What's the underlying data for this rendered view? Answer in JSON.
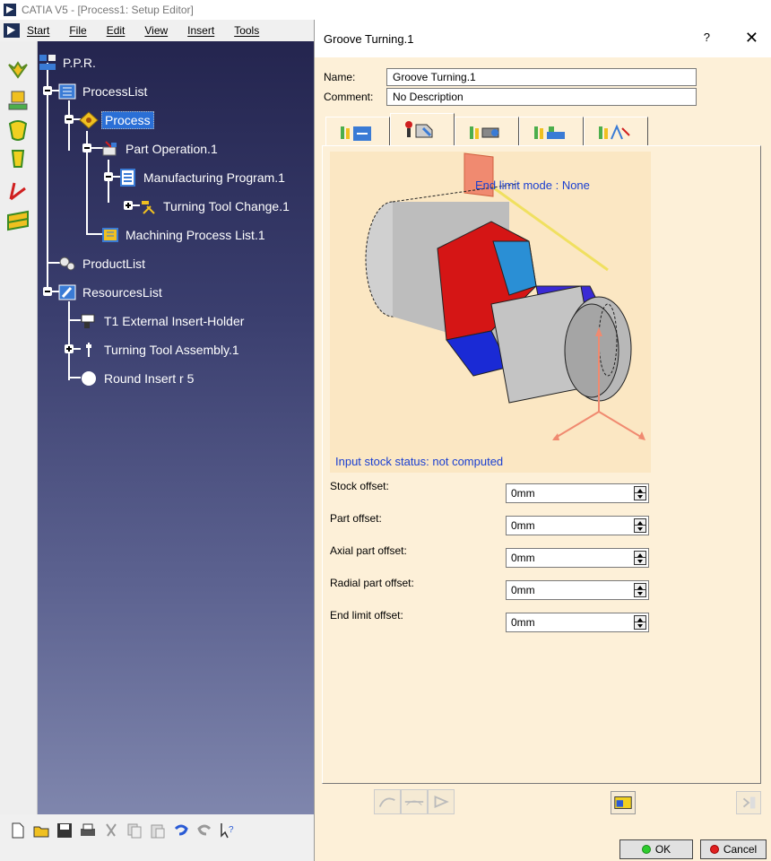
{
  "window": {
    "title": "CATIA V5 - [Process1: Setup Editor]"
  },
  "menu": {
    "items": [
      {
        "label": "Start"
      },
      {
        "label": "File"
      },
      {
        "label": "Edit"
      },
      {
        "label": "View"
      },
      {
        "label": "Insert"
      },
      {
        "label": "Tools"
      }
    ]
  },
  "tree": {
    "nodes": [
      {
        "label": "P.P.R."
      },
      {
        "label": "ProcessList"
      },
      {
        "label": "Process"
      },
      {
        "label": "Part Operation.1"
      },
      {
        "label": "Manufacturing Program.1"
      },
      {
        "label": "Turning Tool Change.1"
      },
      {
        "label": "Machining Process List.1"
      },
      {
        "label": "ProductList"
      },
      {
        "label": "ResourcesList"
      },
      {
        "label": "T1 External Insert-Holder"
      },
      {
        "label": "Turning Tool Assembly.1"
      },
      {
        "label": "Round Insert r 5"
      }
    ]
  },
  "dialog": {
    "title": "Groove Turning.1",
    "help": "?",
    "close": "✕",
    "name_label": "Name:",
    "name_value": "Groove Turning.1",
    "comment_label": "Comment:",
    "comment_value": "No Description",
    "graphic": {
      "end_limit_mode": "End limit mode : None",
      "stock_status": "Input stock status: not computed"
    },
    "offsets": [
      {
        "label": "Stock offset:",
        "value": "0mm"
      },
      {
        "label": "Part offset:",
        "value": "0mm"
      },
      {
        "label": "Axial part offset:",
        "value": "0mm"
      },
      {
        "label": "Radial part offset:",
        "value": "0mm"
      },
      {
        "label": "End limit offset:",
        "value": "0mm"
      }
    ],
    "ok_label": "OK",
    "cancel_label": "Cancel"
  },
  "colors": {
    "dialog_bg": "#fdf0d8",
    "graphic_bg": "#fbe7c3",
    "blue_text": "#1a3fd1",
    "tree_selected": "#2a6fd6"
  }
}
